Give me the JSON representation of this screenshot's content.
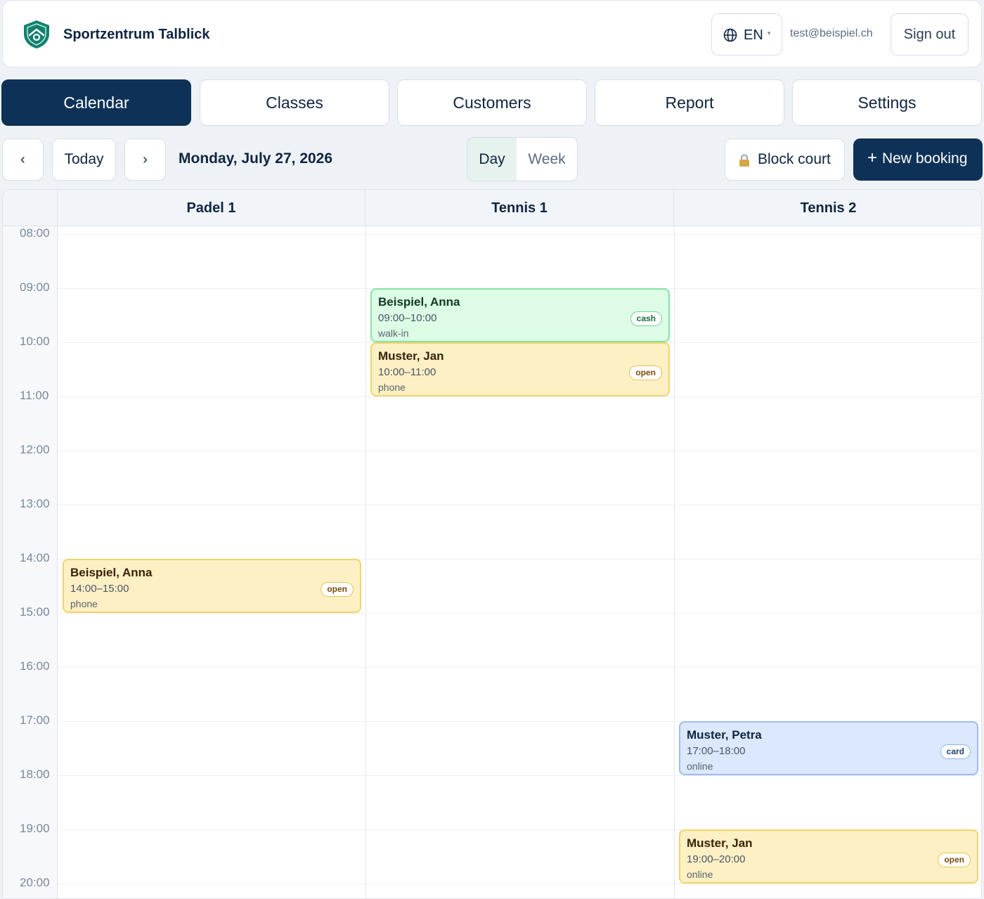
{
  "header": {
    "brand": "Sportzentrum Talblick",
    "language": "EN",
    "user_email": "test@beispiel.ch",
    "sign_out_label": "Sign out",
    "logo_icon": "shield-logo-icon",
    "brand_color": "#13806e"
  },
  "tabs": [
    {
      "label": "Calendar",
      "active": true
    },
    {
      "label": "Classes",
      "active": false
    },
    {
      "label": "Customers",
      "active": false
    },
    {
      "label": "Report",
      "active": false
    },
    {
      "label": "Settings",
      "active": false
    }
  ],
  "toolbar": {
    "prev_label": "‹",
    "today_label": "Today",
    "next_label": "›",
    "date_label": "Monday, July 27, 2026",
    "view_day_label": "Day",
    "view_week_label": "Week",
    "selected_view": "Day",
    "block_court_label": "Block court",
    "new_booking_label": "New booking",
    "new_booking_plus": "+"
  },
  "calendar": {
    "courts": [
      "Padel 1",
      "Tennis 1",
      "Tennis 2"
    ],
    "hours": [
      "08:00",
      "09:00",
      "10:00",
      "11:00",
      "12:00",
      "13:00",
      "14:00",
      "15:00",
      "16:00",
      "17:00",
      "18:00",
      "19:00",
      "20:00"
    ],
    "bookings": [
      {
        "court": "Tennis 1",
        "name": "Beispiel, Anna",
        "time": "09:00–10:00",
        "source": "walk-in",
        "payment": "cash",
        "color": "green"
      },
      {
        "court": "Tennis 1",
        "name": "Muster, Jan",
        "time": "10:00–11:00",
        "source": "phone",
        "payment": "open",
        "color": "yellow"
      },
      {
        "court": "Padel 1",
        "name": "Beispiel, Anna",
        "time": "14:00–15:00",
        "source": "phone",
        "payment": "open",
        "color": "yellow"
      },
      {
        "court": "Tennis 2",
        "name": "Muster, Petra",
        "time": "17:00–18:00",
        "source": "online",
        "payment": "card",
        "color": "blue"
      },
      {
        "court": "Tennis 2",
        "name": "Muster, Jan",
        "time": "19:00–20:00",
        "source": "online",
        "payment": "open",
        "color": "yellow"
      }
    ]
  },
  "colors": {
    "primary": "#0e3157",
    "booking_green": "#dcfce6",
    "booking_yellow": "#fdf0c4",
    "booking_blue": "#dbe8fd"
  }
}
